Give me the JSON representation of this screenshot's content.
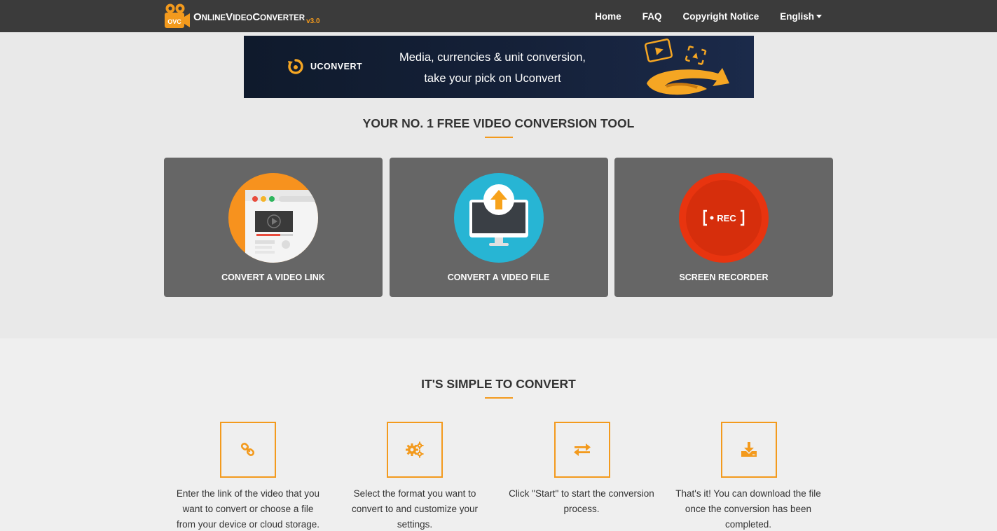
{
  "header": {
    "logo_badge": "OVC",
    "logo_parts": [
      {
        "text": "O",
        "small": false
      },
      {
        "text": "NLINE",
        "small": true
      },
      {
        "text": "V",
        "small": false
      },
      {
        "text": "IDEO",
        "small": true
      },
      {
        "text": "C",
        "small": false
      },
      {
        "text": "ONVERTER",
        "small": true
      }
    ],
    "logo_version": "v3.0",
    "nav": {
      "home": "Home",
      "faq": "FAQ",
      "copyright": "Copyright Notice",
      "language": "English"
    }
  },
  "banner": {
    "brand": "UCONVERT",
    "line1": "Media, currencies & unit conversion,",
    "line2": "take your pick on Uconvert"
  },
  "hero": {
    "title": "YOUR NO. 1 FREE VIDEO CONVERSION TOOL",
    "cards": [
      {
        "label": "CONVERT A VIDEO LINK",
        "icon": "video-link-icon",
        "color": "#f7921e"
      },
      {
        "label": "CONVERT A VIDEO FILE",
        "icon": "upload-monitor-icon",
        "color": "#27b5d4"
      },
      {
        "label": "SCREEN RECORDER",
        "icon": "rec-icon",
        "color": "#e8340f",
        "rec_text": "REC"
      }
    ]
  },
  "how": {
    "title": "IT'S SIMPLE TO CONVERT",
    "steps": [
      {
        "icon": "link-icon",
        "lines": [
          "Enter the link of the video that you",
          "want to convert or choose a file",
          "from your device or cloud storage."
        ]
      },
      {
        "icon": "gears-icon",
        "lines": [
          "Select the format you want to",
          "convert to and customize your",
          "settings."
        ]
      },
      {
        "icon": "swap-arrows-icon",
        "lines": [
          "Click \"Start\" to start the conversion",
          "process."
        ]
      },
      {
        "icon": "download-icon",
        "lines": [
          "That's it! You can download the file",
          "once the conversion has been",
          "completed."
        ]
      }
    ]
  },
  "colors": {
    "accent": "#f39a1d",
    "topbar": "#3b3b3b",
    "card": "#666666"
  }
}
